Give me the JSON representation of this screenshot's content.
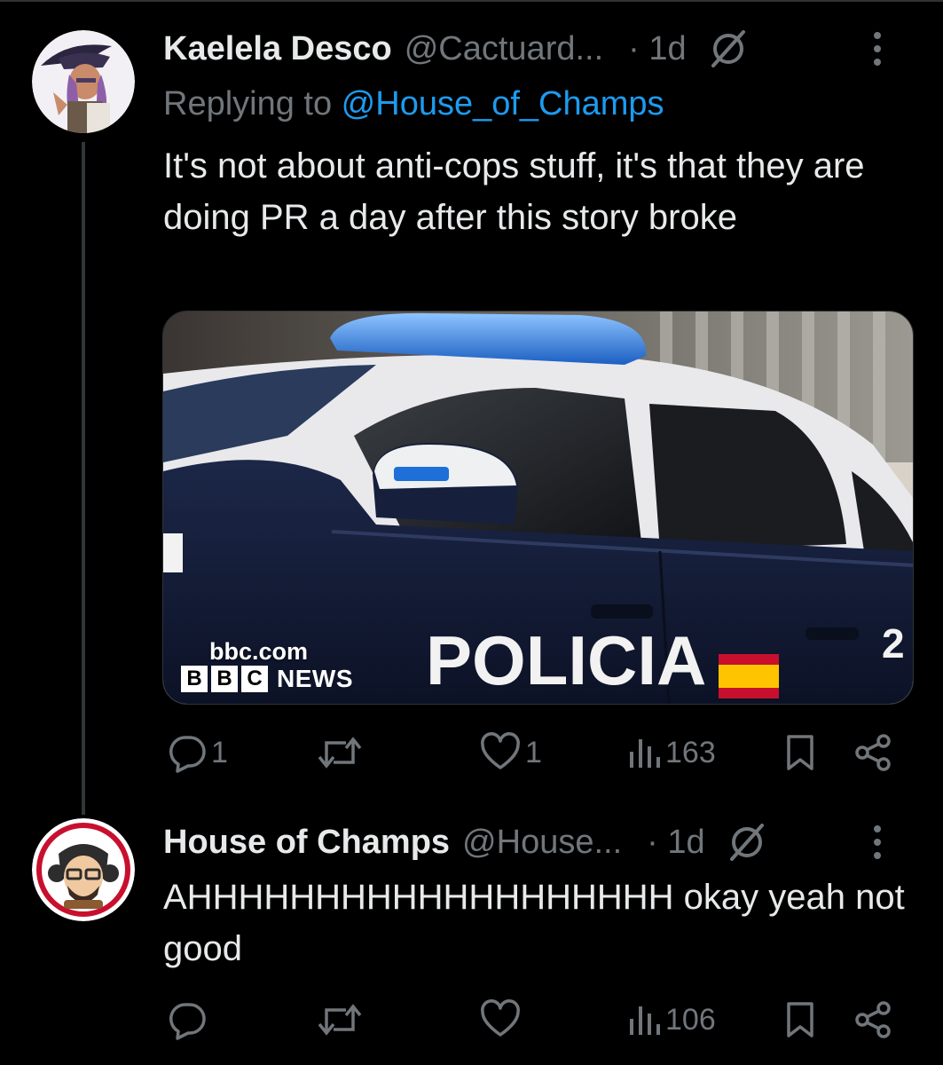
{
  "tweets": [
    {
      "display_name": "Kaelela Desco",
      "handle": "@Cactuard...",
      "time": "· 1d",
      "replying_prefix": "Replying to ",
      "replying_to": "@House_of_Champs",
      "text": "It's not about anti-cops stuff, it's that they are doing PR a day after this story broke",
      "card": {
        "domain": "bbc.com",
        "logo_letters": [
          "B",
          "B",
          "C"
        ],
        "logo_word": "NEWS",
        "car_text": "POLICIA"
      },
      "actions": {
        "replies": "1",
        "reposts": "",
        "likes": "1",
        "views": "163"
      }
    },
    {
      "display_name": "House of Champs",
      "handle": "@House...",
      "time": "· 1d",
      "text": "AHHHHHHHHHHHHHHHHHHH okay yeah not good",
      "actions": {
        "replies": "",
        "reposts": "",
        "likes": "",
        "views": "106"
      }
    }
  ],
  "colors": {
    "background": "#000000",
    "text_primary": "#e7e9ea",
    "text_secondary": "#71767b",
    "accent": "#1d9bf0",
    "divider": "#2f3336"
  },
  "icons": {
    "reply": "speech-bubble-icon",
    "repost": "repost-arrows-icon",
    "like": "heart-icon",
    "views": "bar-chart-icon",
    "bookmark": "bookmark-icon",
    "share": "share-icon",
    "grok": "slashed-circle-icon",
    "more": "vertical-dots-icon"
  }
}
